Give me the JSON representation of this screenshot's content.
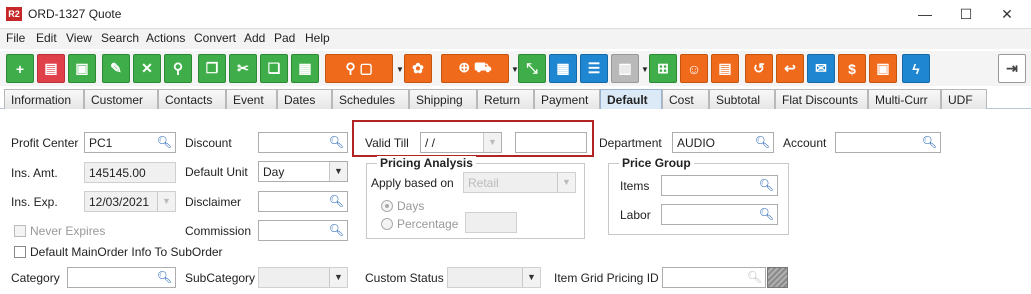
{
  "window": {
    "logo": "R2",
    "title": "ORD-1327 Quote",
    "minimize": "—",
    "maximize": "☐",
    "close": "✕"
  },
  "menu": [
    "File",
    "Edit",
    "View",
    "Search",
    "Actions",
    "Convert",
    "Add",
    "Pad",
    "Help"
  ],
  "toolbar": {
    "icons": [
      "new-document-icon",
      "print-icon",
      "save-icon",
      "edit-icon",
      "delete-icon",
      "search-icon",
      "copy-icon",
      "cut-icon",
      "paste-icon",
      "clipboard-icon",
      "quote-search-icon",
      "workflow-icon",
      "cart-add-icon",
      "resize-icon",
      "grid-icon",
      "message-icon",
      "calendar-icon",
      "org-chart-icon",
      "smile-icon",
      "document-list-icon",
      "revert-icon",
      "return-icon",
      "chat-icon",
      "payment-icon",
      "money-icon",
      "lightning-icon",
      "exit-icon"
    ]
  },
  "tabs": [
    "Information",
    "Customer",
    "Contacts",
    "Event",
    "Dates",
    "Schedules",
    "Shipping",
    "Return",
    "Payment",
    "Default",
    "Cost",
    "Subtotal",
    "Flat Discounts",
    "Multi-Curr",
    "UDF"
  ],
  "active_tab": "Default",
  "form": {
    "profit_center_label": "Profit Center",
    "profit_center_value": "PC1",
    "ins_amt_label": "Ins. Amt.",
    "ins_amt_value": "145145.00",
    "ins_exp_label": "Ins. Exp.",
    "ins_exp_value": "12/03/2021",
    "never_expires_label": "Never Expires",
    "default_mainorder_label": "Default MainOrder Info To SubOrder",
    "discount_label": "Discount",
    "default_unit_label": "Default Unit",
    "default_unit_value": "Day",
    "disclaimer_label": "Disclaimer",
    "commission_label": "Commission",
    "valid_till_label": "Valid Till",
    "valid_till_value": "/ /",
    "pricing_analysis_title": "Pricing Analysis",
    "apply_based_on_label": "Apply based on",
    "apply_based_on_value": "Retail",
    "days_label": "Days",
    "percentage_label": "Percentage",
    "department_label": "Department",
    "department_value": "AUDIO",
    "account_label": "Account",
    "price_group_title": "Price Group",
    "items_label": "Items",
    "labor_label": "Labor",
    "category_label": "Category",
    "subcategory_label": "SubCategory",
    "custom_status_label": "Custom Status",
    "item_grid_label": "Item Grid Pricing ID"
  }
}
